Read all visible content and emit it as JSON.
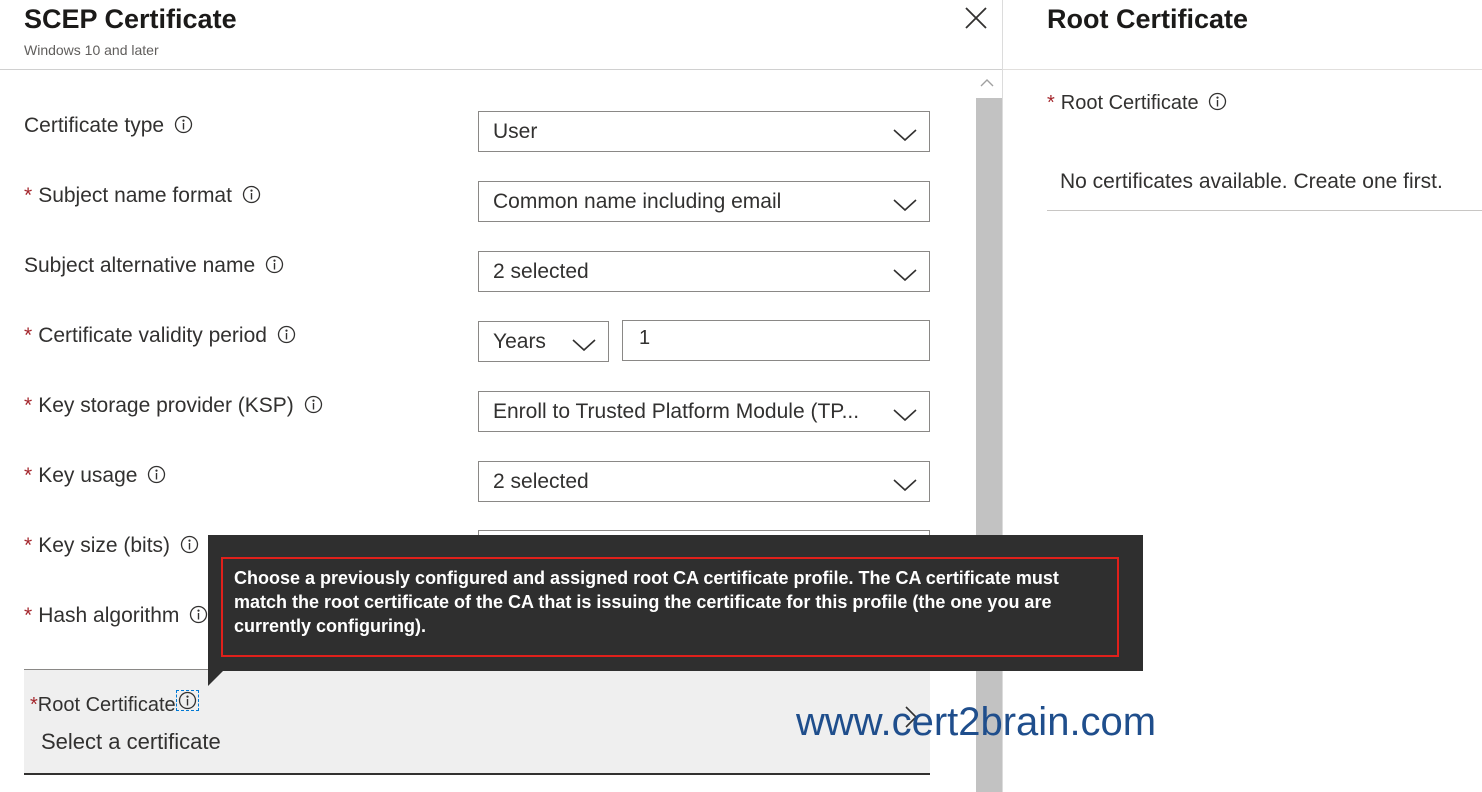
{
  "left_blade": {
    "title": "SCEP Certificate",
    "subtitle": "Windows 10 and later",
    "fields": {
      "certificate_type": {
        "label": "Certificate type",
        "required": false,
        "value": "User"
      },
      "subject_name_format": {
        "label": "Subject name format",
        "required": true,
        "value": "Common name including email"
      },
      "subject_alternative_name": {
        "label": "Subject alternative name",
        "required": false,
        "value": "2 selected"
      },
      "validity_period": {
        "label": "Certificate validity period",
        "required": true,
        "unit": "Years",
        "value": "1"
      },
      "ksp": {
        "label": "Key storage provider (KSP)",
        "required": true,
        "value": "Enroll to Trusted Platform Module (TP..."
      },
      "key_usage": {
        "label": "Key usage",
        "required": true,
        "value": "2 selected"
      },
      "key_size": {
        "label": "Key size (bits)",
        "required": true
      },
      "hash_algorithm": {
        "label": "Hash algorithm",
        "required": true
      }
    },
    "required_marker": "*",
    "root_certificate": {
      "label": "Root Certificate",
      "value": "Select a certificate"
    },
    "tooltip": "Choose a previously configured and assigned root CA certificate profile. The CA certificate must match the root certificate of the CA that is issuing the certificate for this profile (the one you are currently configuring)."
  },
  "right_blade": {
    "title": "Root Certificate",
    "field_label": "Root Certificate",
    "empty_message": "No certificates available. Create one first."
  },
  "watermark": "www.cert2brain.com",
  "icons": [
    "close-icon",
    "info-icon",
    "chevron-down-icon",
    "chevron-right-icon",
    "scroll-up-icon"
  ],
  "colors": {
    "required": "#a4262c",
    "tooltip_bg": "#2f2f2f",
    "tooltip_outline": "#e0201b",
    "watermark": "#1f4e8c",
    "focus": "#0078d4"
  }
}
